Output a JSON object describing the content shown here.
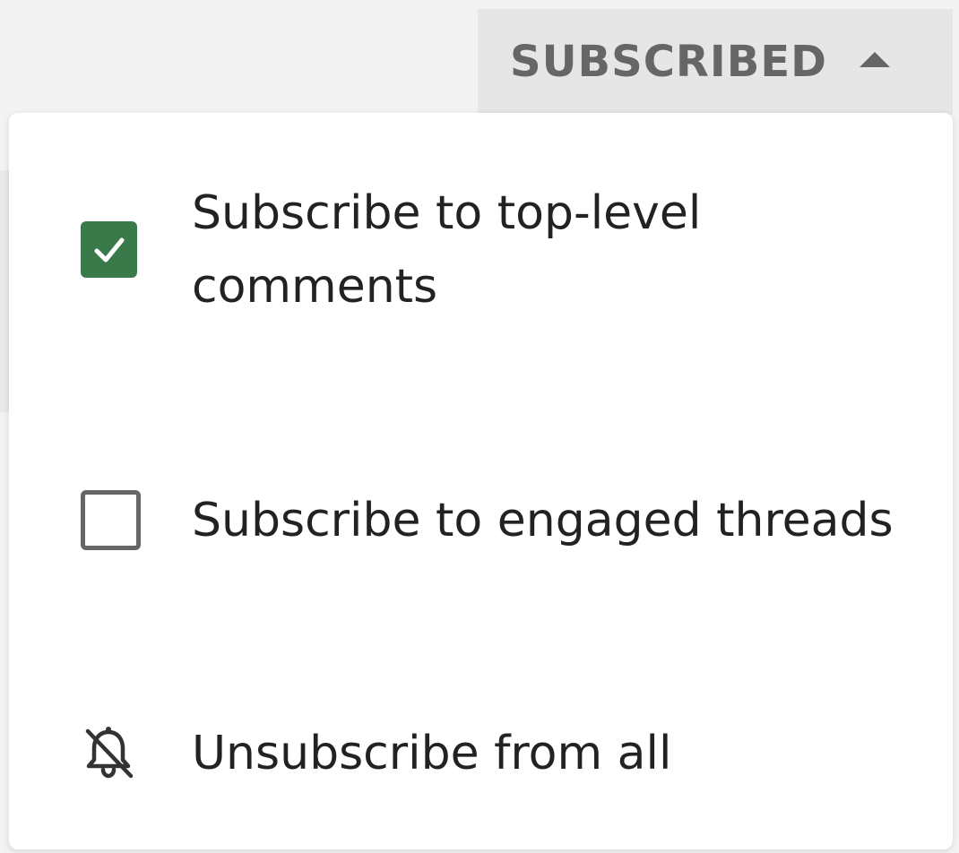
{
  "header": {
    "subscribed_label": "SUBSCRIBED"
  },
  "menu": {
    "items": [
      {
        "label": "Subscribe to top-level comments",
        "checked": true,
        "icon": "checkbox-checked-icon"
      },
      {
        "label": "Subscribe to engaged threads",
        "checked": false,
        "icon": "checkbox-unchecked-icon"
      },
      {
        "label": "Unsubscribe from all",
        "icon": "bell-off-icon"
      }
    ]
  },
  "colors": {
    "accent_green": "#3a7a4a",
    "header_bg": "#e6e6e6",
    "header_text": "#666666",
    "menu_text": "#222222"
  }
}
